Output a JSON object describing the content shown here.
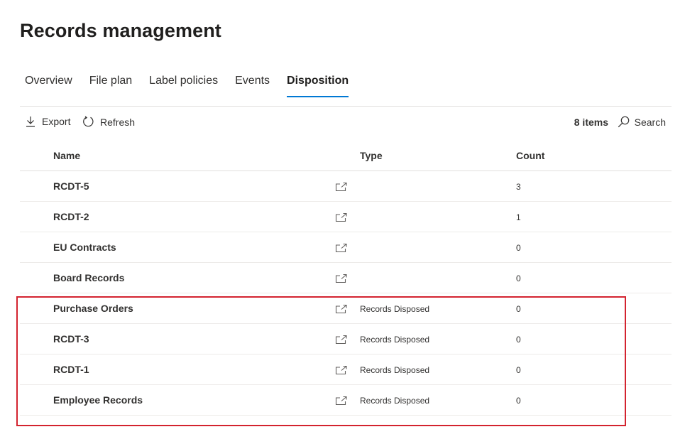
{
  "page": {
    "title": "Records management"
  },
  "tabs": [
    {
      "label": "Overview",
      "active": false
    },
    {
      "label": "File plan",
      "active": false
    },
    {
      "label": "Label policies",
      "active": false
    },
    {
      "label": "Events",
      "active": false
    },
    {
      "label": "Disposition",
      "active": true
    }
  ],
  "toolbar": {
    "export_label": "Export",
    "refresh_label": "Refresh",
    "item_count": "8 items",
    "search_label": "Search"
  },
  "table": {
    "columns": {
      "name": "Name",
      "type": "Type",
      "count": "Count"
    },
    "rows": [
      {
        "name": "RCDT-5",
        "type": "",
        "count": "3"
      },
      {
        "name": "RCDT-2",
        "type": "",
        "count": "1"
      },
      {
        "name": "EU Contracts",
        "type": "",
        "count": "0"
      },
      {
        "name": "Board Records",
        "type": "",
        "count": "0"
      },
      {
        "name": "Purchase Orders",
        "type": "Records Disposed",
        "count": "0"
      },
      {
        "name": "RCDT-3",
        "type": "Records Disposed",
        "count": "0"
      },
      {
        "name": "RCDT-1",
        "type": "Records Disposed",
        "count": "0"
      },
      {
        "name": "Employee Records",
        "type": "Records Disposed",
        "count": "0"
      }
    ]
  },
  "icons": {
    "export": "download-icon",
    "refresh": "refresh-icon",
    "search": "search-icon",
    "row_action": "open-in-new-window-icon"
  },
  "colors": {
    "accent": "#0078d4",
    "highlight": "#d3232f",
    "text": "#323130"
  }
}
